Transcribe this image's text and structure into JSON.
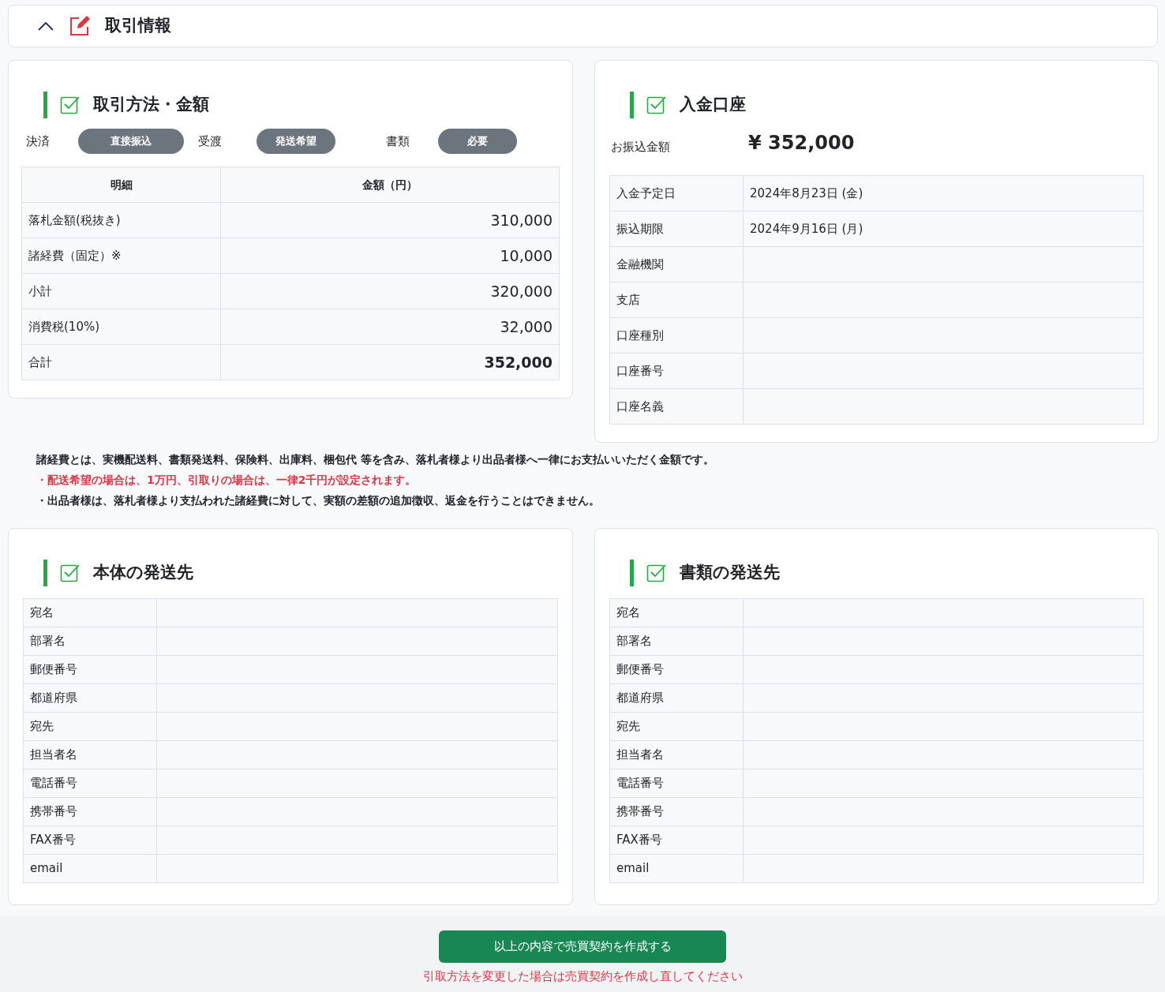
{
  "header": {
    "title": "取引情報",
    "expanded": true
  },
  "method_card": {
    "title": "取引方法・金額",
    "tags": [
      {
        "label": "決済",
        "value": "直接振込"
      },
      {
        "label": "受渡",
        "value": "発送希望"
      },
      {
        "label": "書類",
        "value": "必要"
      }
    ],
    "columns": [
      "明細",
      "金額（円）"
    ],
    "rows": [
      {
        "label": "落札金額(税抜き)",
        "amount": "310,000",
        "bold": false
      },
      {
        "label": "諸経費（固定）※",
        "amount": "10,000",
        "bold": false
      },
      {
        "label": "小計",
        "amount": "320,000",
        "bold": false
      },
      {
        "label": "消費税(10%)",
        "amount": "32,000",
        "bold": false
      },
      {
        "label": "合計",
        "amount": "352,000",
        "bold": true
      }
    ]
  },
  "bank_card": {
    "title": "入金口座",
    "amount_label": "お振込金額",
    "amount": "¥ 352,000",
    "rows": [
      {
        "label": "入金予定日",
        "value": "2024年8月23日 (金)"
      },
      {
        "label": "振込期限",
        "value": "2024年9月16日 (月)"
      },
      {
        "label": "金融機関"
      },
      {
        "label": "支店"
      },
      {
        "label": "口座種別"
      },
      {
        "label": "口座番号"
      },
      {
        "label": "口座名義"
      }
    ]
  },
  "notes": [
    {
      "text": "諸経費とは、実機配送料、書類発送料、保険料、出庫料、梱包代 等を含み、落札者様より出品者様へ一律にお支払いいただく金額です。",
      "kind": "normal"
    },
    {
      "text": "・配送希望の場合は、1万円、引取りの場合は、一律2千円が設定されます。",
      "kind": "warning"
    },
    {
      "text": "・出品者様は、落札者様より支払われた諸経費に対して、実額の差額の追加徴収、返金を行うことはできません。",
      "kind": "normal"
    }
  ],
  "shipping_cards": [
    {
      "title": "本体の発送先",
      "rows": [
        "宛名",
        "部署名",
        "郵便番号",
        "都道府県",
        "宛先",
        "担当者名",
        "電話番号",
        "携帯番号",
        "FAX番号",
        "email"
      ]
    },
    {
      "title": "書類の発送先",
      "rows": [
        "宛名",
        "部署名",
        "郵便番号",
        "都道府県",
        "宛先",
        "担当者名",
        "電話番号",
        "携帯番号",
        "FAX番号",
        "email"
      ]
    }
  ],
  "footer": {
    "button": "以上の内容で売買契約を作成する",
    "note": "引取方法を変更した場合は売買契約を作成し直してください"
  }
}
